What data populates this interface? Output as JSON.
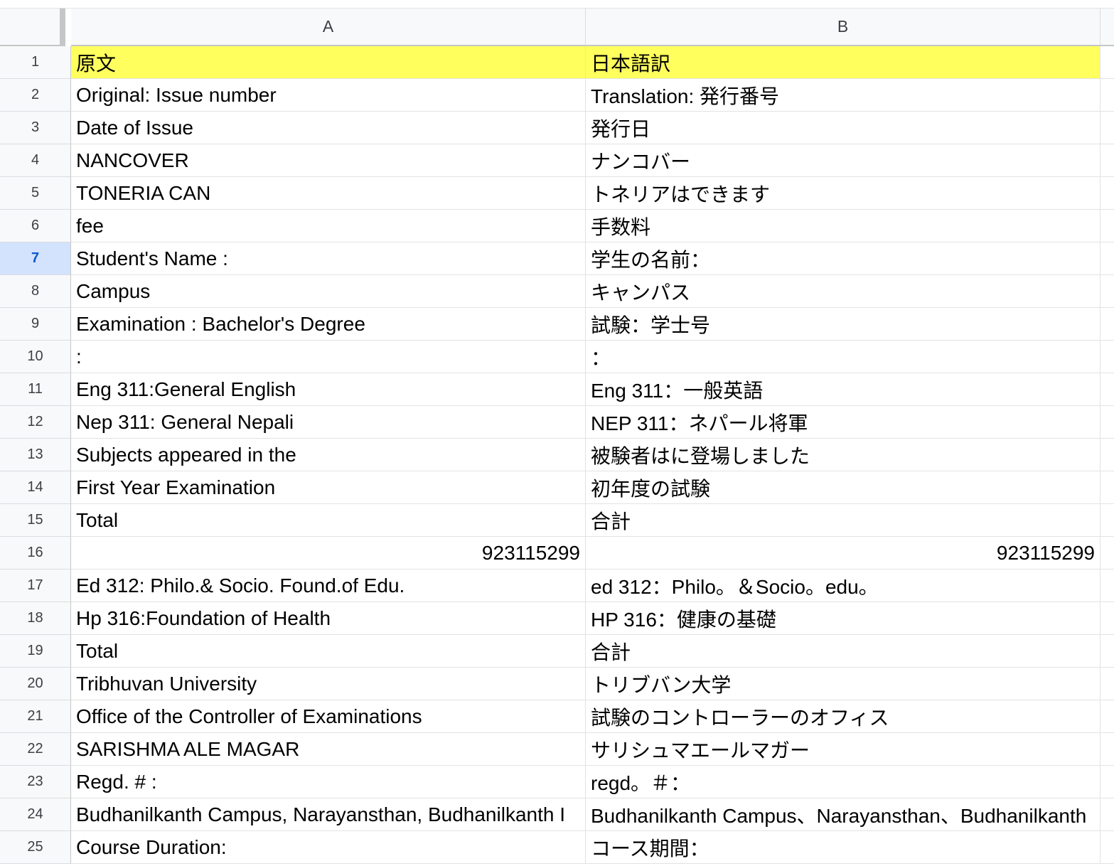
{
  "sheet": {
    "columns": [
      "A",
      "B"
    ],
    "active_row": 7,
    "header_fill": "#ffff5e",
    "rows": [
      {
        "n": "1",
        "a": "原文",
        "b": "日本語訳"
      },
      {
        "n": "2",
        "a": "Original: Issue number",
        "b": "Translation: 発行番号"
      },
      {
        "n": "3",
        "a": "Date of Issue",
        "b": "発行日"
      },
      {
        "n": "4",
        "a": "NANCOVER",
        "b": "ナンコバー"
      },
      {
        "n": "5",
        "a": "TONERIA CAN",
        "b": "トネリアはできます"
      },
      {
        "n": "6",
        "a": "fee",
        "b": "手数料"
      },
      {
        "n": "7",
        "a": "Student's Name :",
        "b": "学生の名前："
      },
      {
        "n": "8",
        "a": "Campus",
        "b": "キャンパス"
      },
      {
        "n": "9",
        "a": "Examination : Bachelor's Degree",
        "b": "試験：学士号"
      },
      {
        "n": "10",
        "a": ":",
        "b": "："
      },
      {
        "n": "11",
        "a": "Eng 311:General English",
        "b": "Eng 311：一般英語"
      },
      {
        "n": "12",
        "a": "Nep 311: General Nepali",
        "b": "NEP 311：ネパール将軍"
      },
      {
        "n": "13",
        "a": "Subjects appeared in the",
        "b": "被験者はに登場しました"
      },
      {
        "n": "14",
        "a": "First Year Examination",
        "b": "初年度の試験"
      },
      {
        "n": "15",
        "a": "Total",
        "b": "合計"
      },
      {
        "n": "16",
        "a": "923115299",
        "b": "923115299"
      },
      {
        "n": "17",
        "a": "Ed 312: Philo.& Socio. Found.of Edu.",
        "b": "ed 312：Philo。＆Socio。edu。"
      },
      {
        "n": "18",
        "a": "Hp 316:Foundation of Health",
        "b": "HP 316：健康の基礎"
      },
      {
        "n": "19",
        "a": "Total",
        "b": "合計"
      },
      {
        "n": "20",
        "a": "Tribhuvan University",
        "b": "トリブバン大学"
      },
      {
        "n": "21",
        "a": "Office of the Controller of Examinations",
        "b": "試験のコントローラーのオフィス"
      },
      {
        "n": "22",
        "a": "SARISHMA ALE MAGAR",
        "b": "サリシュマエールマガー"
      },
      {
        "n": "23",
        "a": "Regd. # :",
        "b": "regd。＃："
      },
      {
        "n": "24",
        "a": "Budhanilkanth Campus, Narayansthan, Budhanilkanth I",
        "b": "Budhanilkanth Campus、Narayansthan、Budhanilkanth"
      },
      {
        "n": "25",
        "a": "Course Duration:",
        "b": "コース期間："
      }
    ]
  }
}
